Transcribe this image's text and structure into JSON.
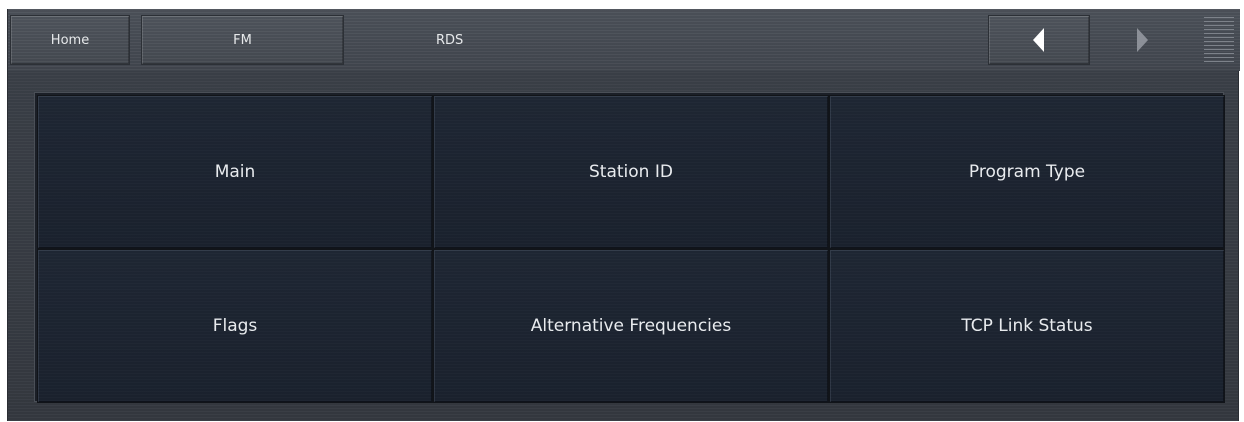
{
  "navbar": {
    "breadcrumbs": [
      "Home",
      "FM",
      "RDS"
    ],
    "back_icon": "triangle-left-icon",
    "forward_icon": "triangle-right-icon",
    "menu_icon": "hamburger-menu-icon"
  },
  "grid": {
    "tiles": [
      "Main",
      "Station ID",
      "Program Type",
      "Flags",
      "Alternative Frequencies",
      "TCP Link Status"
    ]
  },
  "colors": {
    "tile_background": "#1c2330",
    "navbar_background": "#454a52",
    "text": "#e8ebee"
  }
}
